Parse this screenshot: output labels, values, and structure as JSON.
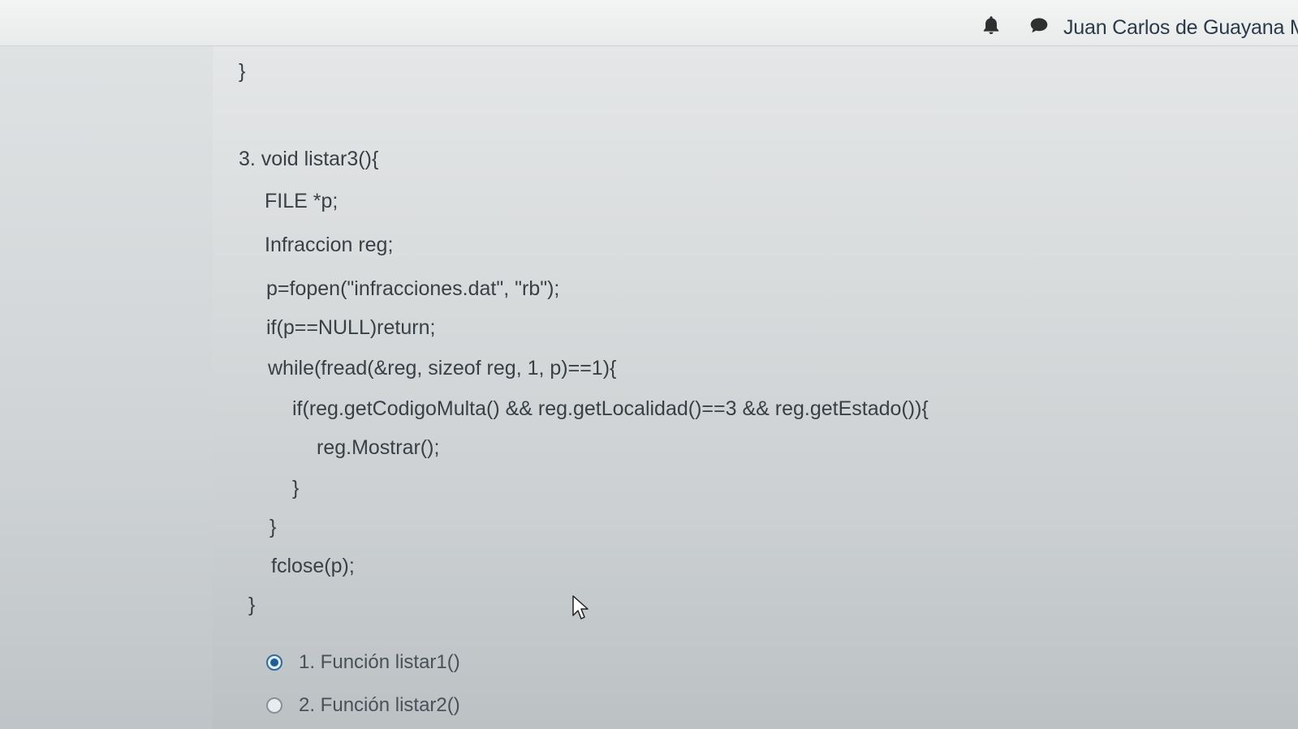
{
  "header": {
    "user_name": "Juan Carlos de Guayana Mu",
    "icons": [
      "bell-icon",
      "chat-icon"
    ]
  },
  "question": {
    "prev_brace": "}",
    "code_lines": [
      "3. void listar3(){",
      "FILE *p;",
      "Infraccion reg;",
      "p=fopen(\"infracciones.dat\", \"rb\");",
      "if(p==NULL)return;",
      "while(fread(&reg, sizeof reg, 1, p)==1){",
      "if(reg.getCodigoMulta() && reg.getLocalidad()==3 && reg.getEstado()){",
      "reg.Mostrar();",
      "}",
      "}",
      "fclose(p);",
      "}"
    ],
    "options": [
      {
        "label": "1. Función listar1()",
        "selected": true
      },
      {
        "label": "2. Función listar2()",
        "selected": false
      }
    ]
  }
}
